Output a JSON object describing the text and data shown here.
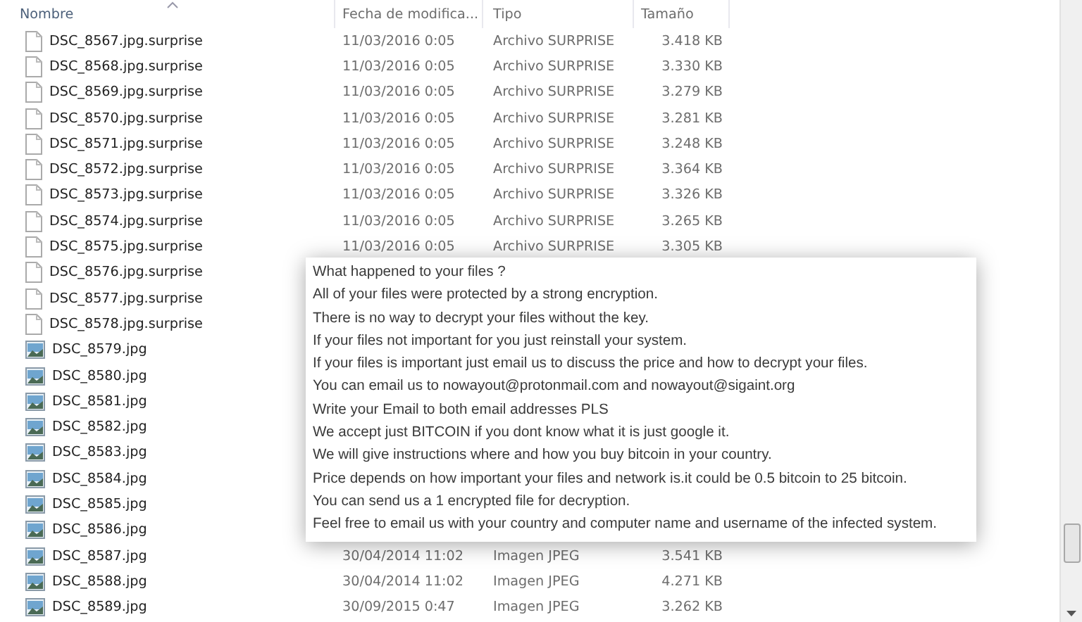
{
  "columns": [
    "Nombre",
    "Fecha de modifica...",
    "Tipo",
    "Tamaño"
  ],
  "rows": [
    {
      "kind": "file",
      "name": "DSC_8567.jpg.surprise",
      "date": "11/03/2016 0:05",
      "type": "Archivo SURPRISE",
      "size": "3.418 KB"
    },
    {
      "kind": "file",
      "name": "DSC_8568.jpg.surprise",
      "date": "11/03/2016 0:05",
      "type": "Archivo SURPRISE",
      "size": "3.330 KB"
    },
    {
      "kind": "file",
      "name": "DSC_8569.jpg.surprise",
      "date": "11/03/2016 0:05",
      "type": "Archivo SURPRISE",
      "size": "3.279 KB"
    },
    {
      "kind": "file",
      "name": "DSC_8570.jpg.surprise",
      "date": "11/03/2016 0:05",
      "type": "Archivo SURPRISE",
      "size": "3.281 KB"
    },
    {
      "kind": "file",
      "name": "DSC_8571.jpg.surprise",
      "date": "11/03/2016 0:05",
      "type": "Archivo SURPRISE",
      "size": "3.248 KB"
    },
    {
      "kind": "file",
      "name": "DSC_8572.jpg.surprise",
      "date": "11/03/2016 0:05",
      "type": "Archivo SURPRISE",
      "size": "3.364 KB"
    },
    {
      "kind": "file",
      "name": "DSC_8573.jpg.surprise",
      "date": "11/03/2016 0:05",
      "type": "Archivo SURPRISE",
      "size": "3.326 KB"
    },
    {
      "kind": "file",
      "name": "DSC_8574.jpg.surprise",
      "date": "11/03/2016 0:05",
      "type": "Archivo SURPRISE",
      "size": "3.265 KB"
    },
    {
      "kind": "file",
      "name": "DSC_8575.jpg.surprise",
      "date": "11/03/2016 0:05",
      "type": "Archivo SURPRISE",
      "size": "3.305 KB"
    },
    {
      "kind": "file",
      "name": "DSC_8576.jpg.surprise"
    },
    {
      "kind": "file",
      "name": "DSC_8577.jpg.surprise"
    },
    {
      "kind": "file",
      "name": "DSC_8578.jpg.surprise"
    },
    {
      "kind": "image",
      "name": "DSC_8579.jpg"
    },
    {
      "kind": "image",
      "name": "DSC_8580.jpg"
    },
    {
      "kind": "image",
      "name": "DSC_8581.jpg"
    },
    {
      "kind": "image",
      "name": "DSC_8582.jpg"
    },
    {
      "kind": "image",
      "name": "DSC_8583.jpg"
    },
    {
      "kind": "image",
      "name": "DSC_8584.jpg"
    },
    {
      "kind": "image",
      "name": "DSC_8585.jpg"
    },
    {
      "kind": "image",
      "name": "DSC_8586.jpg"
    },
    {
      "kind": "image",
      "name": "DSC_8587.jpg",
      "date": "30/04/2014 11:02",
      "type": "Imagen JPEG",
      "size": "3.541 KB"
    },
    {
      "kind": "image",
      "name": "DSC_8588.jpg",
      "date": "30/04/2014 11:02",
      "type": "Imagen JPEG",
      "size": "4.271 KB"
    },
    {
      "kind": "image",
      "name": "DSC_8589.jpg",
      "date": "30/09/2015 0:47",
      "type": "Imagen JPEG",
      "size": "3.262 KB"
    }
  ],
  "note": {
    "lines": [
      "What happened to your files ?",
      "All of your files were protected by a strong encryption.",
      "There is no way to decrypt your files without the key.",
      "If your files not important for you just reinstall your system.",
      "If your files is important just email us to discuss the price and how to decrypt your files.",
      "You can email us to nowayout@protonmail.com and nowayout@sigaint.org",
      "Write your Email to both email addresses PLS",
      "We accept just BITCOIN if you dont know what it is just google it.",
      "We will give instructions where and how you buy bitcoin in your country.",
      "Price depends on how important your files and network is.it could be 0.5 bitcoin to 25 bitcoin.",
      "You can send us a 1 encrypted file for decryption.",
      "Feel free to email us with your country and computer name and username of the infected system."
    ]
  }
}
